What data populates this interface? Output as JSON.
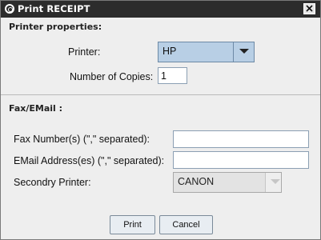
{
  "window": {
    "title": "Print RECEIPT",
    "icon": "circle-logo-icon",
    "close_icon": "close-icon"
  },
  "printer_properties": {
    "heading": "Printer properties:",
    "printer_label": "Printer:",
    "printer_value": "HP",
    "copies_label": "Number of Copies:",
    "copies_value": "1"
  },
  "fax_email": {
    "heading": "Fax/EMail :",
    "fax_label": "Fax Number(s) (\",\" separated):",
    "fax_value": "",
    "email_label": "EMail Address(es) (\",\" separated):",
    "email_value": "",
    "secondary_label": "Secondry Printer:",
    "secondary_value": "CANON"
  },
  "buttons": {
    "print": "Print",
    "cancel": "Cancel"
  },
  "colors": {
    "titlebar": "#2c2c2c",
    "combo_active": "#b8cfe5",
    "window_bg": "#eeeeee"
  }
}
